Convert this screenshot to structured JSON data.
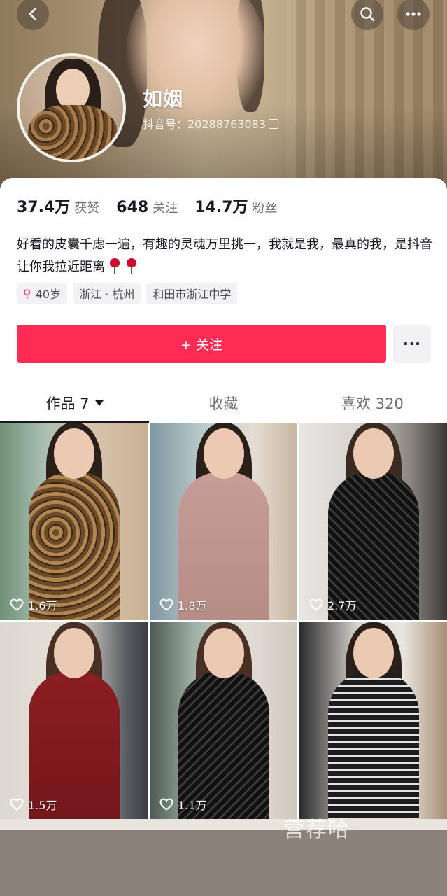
{
  "header": {
    "name": "如姻",
    "douyin_id": "抖音号：20288763083",
    "icons": [
      "back-icon",
      "search-icon",
      "more-icon",
      "copy-icon"
    ]
  },
  "stats": [
    {
      "num": "37.4万",
      "label": "获赞"
    },
    {
      "num": "648",
      "label": "关注"
    },
    {
      "num": "14.7万",
      "label": "粉丝"
    }
  ],
  "bio": "好看的皮囊千虑一遍，有趣的灵魂万里挑一，我就是我，最真的我，是抖音让你我拉近距离",
  "tags": [
    "40岁",
    "浙江 · 杭州",
    "和田市浙江中学"
  ],
  "follow_button": "+ 关注",
  "more_button": "···",
  "tabs": [
    {
      "label": "作品 7",
      "active": true
    },
    {
      "label": "收藏",
      "active": false
    },
    {
      "label": "喜欢 320",
      "active": false
    }
  ],
  "videos": [
    {
      "likes": "1.6万"
    },
    {
      "likes": "1.8万"
    },
    {
      "likes": "2.7万"
    },
    {
      "likes": "1.5万"
    },
    {
      "likes": "1.1万"
    },
    {
      "likes": ""
    }
  ],
  "watermark": "营荐哈",
  "colors": {
    "accent": "#fe2c55",
    "text": "#161823",
    "muted": "#6b6d74"
  }
}
